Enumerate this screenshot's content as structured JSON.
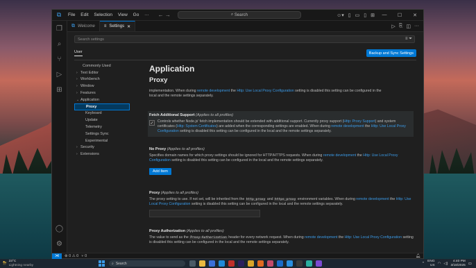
{
  "titlebar": {
    "menu": [
      "File",
      "Edit",
      "Selection",
      "View",
      "Go",
      "···"
    ],
    "search_placeholder": "Search"
  },
  "tabs": [
    {
      "label": "Welcome",
      "active": false
    },
    {
      "label": "Settings",
      "active": true
    }
  ],
  "settings": {
    "search_placeholder": "Search settings",
    "scope_tab": "User",
    "sync_button": "Backup and Sync Settings",
    "toc": [
      {
        "label": "Commonly Used",
        "level": 1,
        "chevron": ""
      },
      {
        "label": "Text Editor",
        "level": 1,
        "chevron": "›"
      },
      {
        "label": "Workbench",
        "level": 1,
        "chevron": "›"
      },
      {
        "label": "Window",
        "level": 1,
        "chevron": "›"
      },
      {
        "label": "Features",
        "level": 1,
        "chevron": "›"
      },
      {
        "label": "Application",
        "level": 1,
        "chevron": "⌄"
      },
      {
        "label": "Proxy",
        "level": 2,
        "selected": true
      },
      {
        "label": "Keyboard",
        "level": 2
      },
      {
        "label": "Update",
        "level": 2
      },
      {
        "label": "Telemetry",
        "level": 2
      },
      {
        "label": "Settings Sync",
        "level": 2
      },
      {
        "label": "Experimental",
        "level": 2
      },
      {
        "label": "Security",
        "level": 1,
        "chevron": "›"
      },
      {
        "label": "Extensions",
        "level": 1,
        "chevron": "›"
      }
    ],
    "section_title": "Application",
    "subsection_title": "Proxy",
    "top_text": {
      "pre": "implementation. Local Proxy Configuration setting is disabled this setting can be configured in the local and the remote settings separately.",
      "part1": "implementation. When during ",
      "link1": "remote development",
      "part2": " the ",
      "link2": "Http: Use Local Proxy Configuration",
      "part3": " setting is disabled this setting can be configured in the",
      "part4": "local and the remote settings separately."
    },
    "fetch": {
      "title": "Fetch Additional Support",
      "scope": "(Applies to all profiles)",
      "checked": true,
      "t1": "Controls whether Node.js' fetch implementation should be extended with additional support. Currently proxy support (",
      "l1": "Http: Proxy Support",
      "t2": ") and system certificates (",
      "l2": "Http: System Certificates",
      "t3": ") are added when the corresponding settings are enabled. When during ",
      "l3": "remote development",
      "t4": " the ",
      "l4": "Http: Use Local Proxy Configuration",
      "t5": " setting is disabled this setting can be configured in the local and the remote settings separately."
    },
    "noproxy": {
      "title": "No Proxy",
      "scope": "(Applies to all profiles)",
      "t1": "Specifies domain names for which proxy settings should be ignored for HTTP/HTTPS requests. When during ",
      "l1": "remote development",
      "t2": " the ",
      "l2": "Http: Use Local Proxy Configuration",
      "t3": " setting is disabled this setting can be configured in the local and the remote settings separately.",
      "button": "Add Item"
    },
    "proxy": {
      "title": "Proxy",
      "scope": "(Applies to all profiles)",
      "t1": "The proxy setting to use. If not set, will be inherited from the ",
      "c1": "http_proxy",
      "t2": " and ",
      "c2": "https_proxy",
      "t3": " environment variables. When during ",
      "l1": "remote development",
      "t4": " the ",
      "l2": "Http: Use Local Proxy Configuration",
      "t5": " setting is disabled this setting can be configured in the local and the remote settings separately.",
      "value": ""
    },
    "proxyauth": {
      "title": "Proxy Authorization",
      "scope": "(Applies to all profiles)",
      "t1": "The value to send as the ",
      "c1": "Proxy-Authorization",
      "t2": " header for every network request. When during ",
      "l1": "remote development",
      "t3": " the ",
      "l2": "Http: Use Local Proxy Configuration",
      "t4": " setting is disabled this setting can be configured in the local and the remote settings separately."
    }
  },
  "statusbar": {
    "problems": "⊗ 0 ⚠ 0",
    "ports": "⑂ 0"
  },
  "taskbar": {
    "temp": "23°C",
    "weather": "Lightning nearby",
    "search": "Search",
    "lang": "ENG",
    "region": "US",
    "time": "4:40 PM",
    "date": "3/18/2025"
  },
  "colors": {
    "accent": "#0078d4",
    "link": "#3b9be8",
    "editor_bg": "#1f1f1f",
    "toc_selected": "#04395e"
  }
}
